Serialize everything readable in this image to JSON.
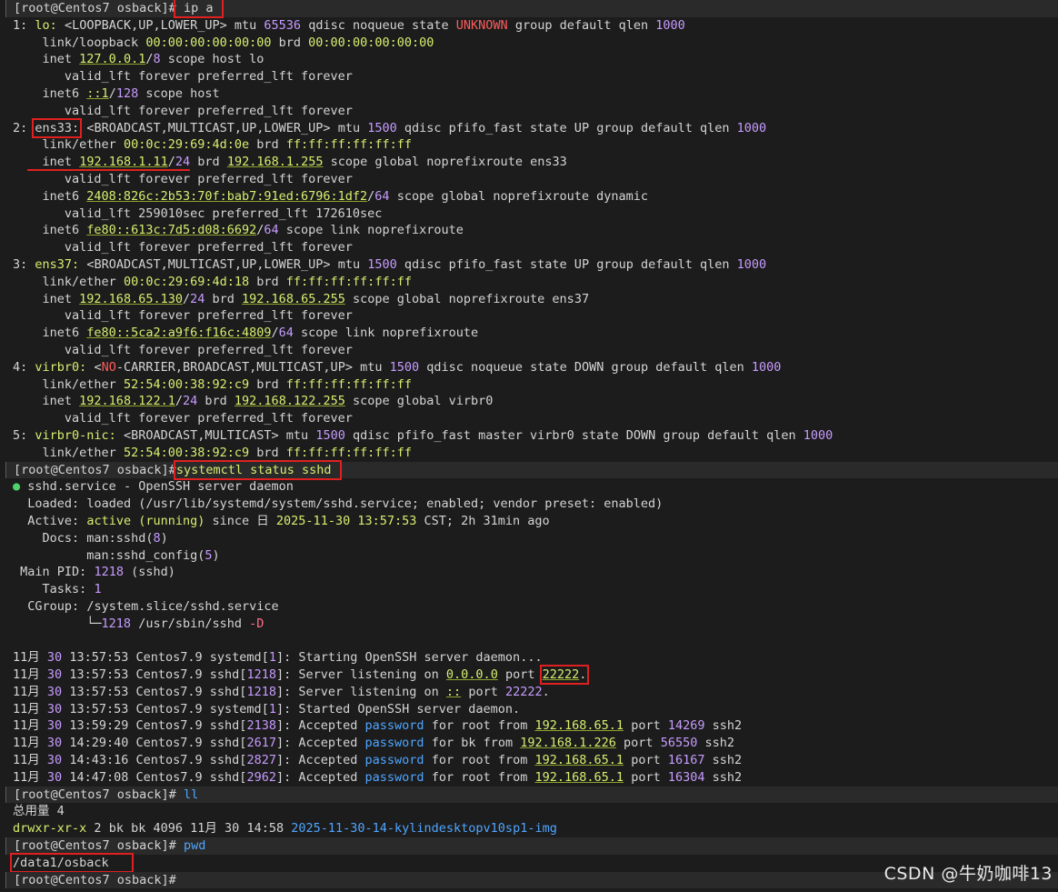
{
  "prompt": "[root@Centos7 osback]#",
  "commands": {
    "ip_a": "ip a",
    "systemctl": "systemctl status sshd",
    "ll": "ll",
    "pwd": "pwd"
  },
  "ip_output": {
    "lo": {
      "index": "1:",
      "name": "lo:",
      "flags_pre": "<LOOPBACK,UP,LOWER_UP>",
      "mtu_label": "mtu",
      "mtu": "65536",
      "rest_pre": "qdisc noqueue state",
      "state": "UNKNOWN",
      "rest_post": "group default qlen",
      "qlen": "1000",
      "link_label": "link/loopback",
      "mac": "00:00:00:00:00:00",
      "brd_label": "brd",
      "brd_mac": "00:00:00:00:00:00",
      "inet_label": "inet",
      "inet_addr": "127.0.0.1",
      "inet_slash": "/",
      "inet_prefix": "8",
      "inet_rest": "scope host lo",
      "valid1": "valid_lft forever preferred_lft forever",
      "inet6_label": "inet6",
      "inet6_addr": "::1",
      "inet6_slash": "/",
      "inet6_prefix": "128",
      "inet6_rest": "scope host",
      "valid2": "valid_lft forever preferred_lft forever"
    },
    "ens33": {
      "index": "2:",
      "name": "ens33:",
      "flags": "<BROADCAST,MULTICAST,UP,LOWER_UP>",
      "mtu_label": "mtu",
      "mtu": "1500",
      "rest": "qdisc pfifo_fast state UP group default qlen",
      "qlen": "1000",
      "link_label": "link/ether",
      "mac": "00:0c:29:69:4d:0e",
      "brd_label": "brd",
      "brd_mac": "ff:ff:ff:ff:ff:ff",
      "inet_label": "inet",
      "inet_addr": "192.168.1.11",
      "inet_slash": "/",
      "inet_prefix": "24",
      "inet_brd_label": "brd",
      "inet_brd": "192.168.1.255",
      "inet_rest": "scope global noprefixroute ens33",
      "valid1": "valid_lft forever preferred_lft forever",
      "inet6a_label": "inet6",
      "inet6a_addr": "2408:826c:2b53:70f:bab7:91ed:6796:1df2",
      "inet6a_slash": "/",
      "inet6a_prefix": "64",
      "inet6a_rest": "scope global noprefixroute dynamic",
      "valid2": "valid_lft 259010sec preferred_lft 172610sec",
      "inet6b_label": "inet6",
      "inet6b_addr": "fe80::613c:7d5:d08:6692",
      "inet6b_slash": "/",
      "inet6b_prefix": "64",
      "inet6b_rest": "scope link noprefixroute",
      "valid3": "valid_lft forever preferred_lft forever"
    },
    "ens37": {
      "index": "3:",
      "name": "ens37:",
      "flags": "<BROADCAST,MULTICAST,UP,LOWER_UP>",
      "mtu_label": "mtu",
      "mtu": "1500",
      "rest": "qdisc pfifo_fast state UP group default qlen",
      "qlen": "1000",
      "link_label": "link/ether",
      "mac": "00:0c:29:69:4d:18",
      "brd_label": "brd",
      "brd_mac": "ff:ff:ff:ff:ff:ff",
      "inet_label": "inet",
      "inet_addr": "192.168.65.130",
      "inet_slash": "/",
      "inet_prefix": "24",
      "inet_brd_label": "brd",
      "inet_brd": "192.168.65.255",
      "inet_rest": "scope global noprefixroute ens37",
      "valid1": "valid_lft forever preferred_lft forever",
      "inet6_label": "inet6",
      "inet6_addr": "fe80::5ca2:a9f6:f16c:4809",
      "inet6_slash": "/",
      "inet6_prefix": "64",
      "inet6_rest": "scope link noprefixroute",
      "valid2": "valid_lft forever preferred_lft forever"
    },
    "virbr0": {
      "index": "4:",
      "name": "virbr0:",
      "flags_open": "<",
      "flags_warn": "NO",
      "flags_rest": "-CARRIER,BROADCAST,MULTICAST,UP>",
      "mtu_label": "mtu",
      "mtu": "1500",
      "rest": "qdisc noqueue state DOWN group default qlen",
      "qlen": "1000",
      "link_label": "link/ether",
      "mac": "52:54:00:38:92:c9",
      "brd_label": "brd",
      "brd_mac": "ff:ff:ff:ff:ff:ff",
      "inet_label": "inet",
      "inet_addr": "192.168.122.1",
      "inet_slash": "/",
      "inet_prefix": "24",
      "inet_brd_label": "brd",
      "inet_brd": "192.168.122.255",
      "inet_rest": "scope global virbr0",
      "valid1": "valid_lft forever preferred_lft forever"
    },
    "virbr0nic": {
      "index": "5:",
      "name": "virbr0-nic:",
      "flags": "<BROADCAST,MULTICAST>",
      "mtu_label": "mtu",
      "mtu": "1500",
      "rest": "qdisc pfifo_fast master virbr0 state DOWN group default qlen",
      "qlen": "1000",
      "link_label": "link/ether",
      "mac": "52:54:00:38:92:c9",
      "brd_label": "brd",
      "brd_mac": "ff:ff:ff:ff:ff:ff"
    }
  },
  "sshd_status": {
    "bullet": "●",
    "service_line": "sshd.service - OpenSSH server daemon",
    "loaded_label": "Loaded:",
    "loaded_value": "loaded (/usr/lib/systemd/system/sshd.service; enabled; vendor preset: enabled)",
    "active_label": "Active:",
    "active_state": "active (running)",
    "active_since": "since",
    "active_day": "日",
    "active_time": "2025-11-30 13:57:53",
    "active_rest": "CST; 2h 31min ago",
    "docs_label": "Docs:",
    "docs1_pre": "man:sshd(",
    "docs1_num": "8",
    "docs1_post": ")",
    "docs2_pre": "man:sshd_config(",
    "docs2_num": "5",
    "docs2_post": ")",
    "pid_label": "Main PID:",
    "pid": "1218",
    "pid_rest": "(sshd)",
    "tasks_label": "Tasks:",
    "tasks": "1",
    "cgroup_label": "CGroup:",
    "cgroup": "/system.slice/sshd.service",
    "cgroup_tree": "└─",
    "cgroup_pid": "1218",
    "cgroup_cmd": "/usr/sbin/sshd",
    "cgroup_flag": "-D"
  },
  "logs": [
    {
      "month": "11月",
      "day": "30",
      "time": "13:57:53",
      "host": "Centos7.9",
      "proc": "systemd",
      "pid": "1",
      "msg": "Starting OpenSSH server daemon..."
    },
    {
      "month": "11月",
      "day": "30",
      "time": "13:57:53",
      "host": "Centos7.9",
      "proc": "sshd",
      "pid": "1218",
      "msg_pre": "Server listening on",
      "addr": "0.0.0.0",
      "port_label": "port",
      "port": "22222",
      "dot": "."
    },
    {
      "month": "11月",
      "day": "30",
      "time": "13:57:53",
      "host": "Centos7.9",
      "proc": "sshd",
      "pid": "1218",
      "msg_pre": "Server listening on",
      "addr": "::",
      "port_label": "port",
      "port": "22222",
      "dot": "."
    },
    {
      "month": "11月",
      "day": "30",
      "time": "13:57:53",
      "host": "Centos7.9",
      "proc": "systemd",
      "pid": "1",
      "msg": "Started OpenSSH server daemon."
    },
    {
      "month": "11月",
      "day": "30",
      "time": "13:59:29",
      "host": "Centos7.9",
      "proc": "sshd",
      "pid": "2138",
      "acc": "Accepted",
      "pw": "password",
      "for": "for root from",
      "ip": "192.168.65.1",
      "port_label": "port",
      "port": "14269",
      "tail": "ssh2"
    },
    {
      "month": "11月",
      "day": "30",
      "time": "14:29:40",
      "host": "Centos7.9",
      "proc": "sshd",
      "pid": "2617",
      "acc": "Accepted",
      "pw": "password",
      "for": "for bk from",
      "ip": "192.168.1.226",
      "port_label": "port",
      "port": "56550",
      "tail": "ssh2"
    },
    {
      "month": "11月",
      "day": "30",
      "time": "14:43:16",
      "host": "Centos7.9",
      "proc": "sshd",
      "pid": "2827",
      "acc": "Accepted",
      "pw": "password",
      "for": "for root from",
      "ip": "192.168.65.1",
      "port_label": "port",
      "port": "16167",
      "tail": "ssh2"
    },
    {
      "month": "11月",
      "day": "30",
      "time": "14:47:08",
      "host": "Centos7.9",
      "proc": "sshd",
      "pid": "2962",
      "acc": "Accepted",
      "pw": "password",
      "for": "for root from",
      "ip": "192.168.65.1",
      "port_label": "port",
      "port": "16304",
      "tail": "ssh2"
    }
  ],
  "ll_output": {
    "total": "总用量 4",
    "perm": "drwxr-xr-x",
    "links": "2",
    "owner": "bk bk",
    "size": "4096",
    "month": "11月",
    "day": "30",
    "time": "14:58",
    "name": "2025-11-30-14-kylindesktopv10sp1-img"
  },
  "pwd_output": "/data1/osback",
  "watermark": "CSDN @牛奶咖啡13",
  "colors": {
    "background": "#1c1c1c",
    "prompt_band": "#2a2a2a",
    "number": "#c79bff",
    "address": "#d6ee6f",
    "warning": "#ff5b5b",
    "highlight_box": "#e02020"
  }
}
